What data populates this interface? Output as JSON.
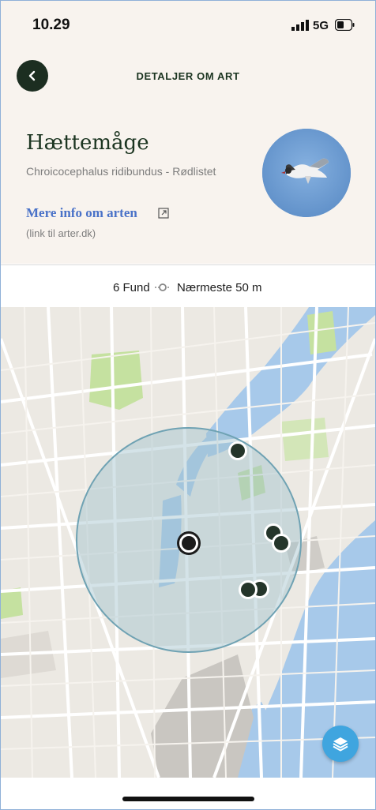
{
  "status_bar": {
    "time": "10.29",
    "network": "5G"
  },
  "nav": {
    "title": "DETALJER OM ART"
  },
  "species": {
    "name": "Hættemåge",
    "latin": "Chroicocephalus ridibundus - Rødlistet",
    "more_info": "Mere info om arten",
    "link_note": "(link til arter.dk)"
  },
  "summary": {
    "count": "6 Fund",
    "nearest": "Nærmeste 50 m"
  },
  "icons": {
    "back": "chevron-left-icon",
    "external": "external-link-icon",
    "distance": "distance-dot-icon",
    "layers": "layers-icon"
  },
  "colors": {
    "header_bg": "#f8f3ee",
    "primary_dark": "#1c3521",
    "link": "#4a72c8",
    "layers_button": "#3fa5df",
    "water": "#a7c9ea",
    "park": "#c5e1a0",
    "search_circle": "#8fb9c8"
  }
}
